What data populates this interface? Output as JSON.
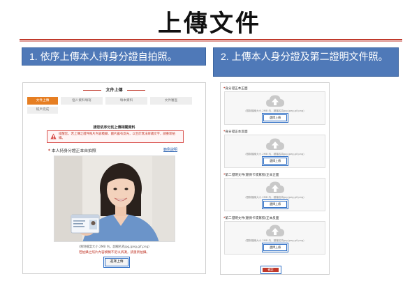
{
  "title": "上傳文件",
  "step_banners": {
    "left": "1. 依序上傳本人持身分證自拍照。",
    "right": "2. 上傳本人身分證及第二證明文件照。"
  },
  "left_screen": {
    "heading": "文件上傳",
    "steps": [
      "文件上傳",
      "個人資料填寫",
      "填本資料",
      "文件審查",
      "帳戶完成"
    ],
    "active_step": 0,
    "subtitle": "請您依序分別上傳相關資料",
    "warning": "提醒您，若上傳之證件照片內容模糊、圖片露有反光，以至於無法辨識文字，請重新拍攝。",
    "field_label": "本人持身分證正本自拍照",
    "example_link": "範例說明",
    "format_note": "(限制檔案大小 2MB 內，副檔名為jpg,jpeg,gif,png)",
    "red_note": "若拍攝之照片內容模糊不足以辨識，請重新拍攝。",
    "upload_button": "選擇上傳",
    "colors": {
      "accent": "#e67e22",
      "warning": "#c0392b",
      "highlight": "#2f6fc6"
    }
  },
  "right_screen": {
    "sections": [
      {
        "label": "身分證正本正面",
        "format_note": "(限制檔案大小 2MB 內，副檔名為jpg,jpeg,gif,png)",
        "button": "選擇上傳"
      },
      {
        "label": "身分證正本反面",
        "format_note": "(限制檔案大小 2MB 內，副檔名為jpg,jpeg,gif,png)",
        "button": "選擇上傳"
      },
      {
        "label": "第二證明文件(健保卡或駕照)正本正面",
        "format_note": "(限制檔案大小 2MB 內，副檔名為jpg,jpeg,gif,png)",
        "button": "選擇上傳"
      },
      {
        "label": "第二證明文件(健保卡或駕照)正本反面",
        "format_note": "(限制檔案大小 2MB 內，副檔名為jpg,jpeg,gif,png)",
        "button": "選擇上傳"
      }
    ],
    "confirm_button": "確認"
  },
  "icons": [
    "warning-icon",
    "cloud-upload-icon"
  ]
}
